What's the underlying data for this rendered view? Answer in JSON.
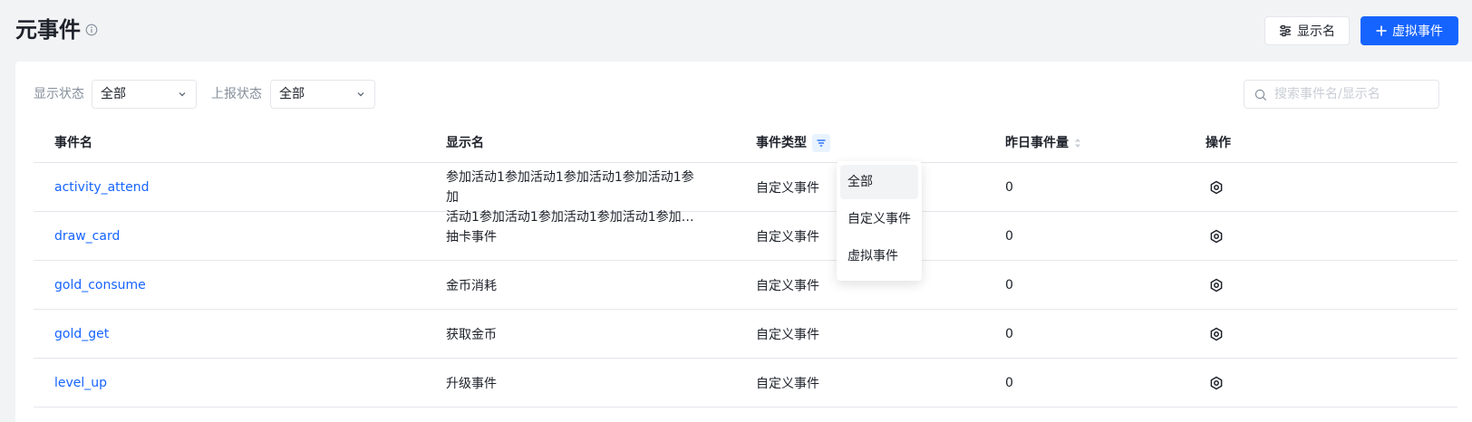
{
  "header": {
    "title": "元事件",
    "display_name_button": "显示名",
    "virtual_event_button": "虚拟事件"
  },
  "filters": {
    "display_status_label": "显示状态",
    "display_status_value": "全部",
    "report_status_label": "上报状态",
    "report_status_value": "全部",
    "search_placeholder": "搜索事件名/显示名"
  },
  "table": {
    "columns": [
      "事件名",
      "显示名",
      "事件类型",
      "昨日事件量",
      "操作"
    ],
    "rows": [
      {
        "event_name": "activity_attend",
        "display_name_line1": "参加活动1参加活动1参加活动1参加活动1参加",
        "display_name_line2": "活动1参加活动1参加活动1参加活动1参加活…",
        "event_type": "自定义事件",
        "yesterday_count": "0"
      },
      {
        "event_name": "draw_card",
        "display_name": "抽卡事件",
        "event_type": "自定义事件",
        "yesterday_count": "0"
      },
      {
        "event_name": "gold_consume",
        "display_name": "金币消耗",
        "event_type": "自定义事件",
        "yesterday_count": "0"
      },
      {
        "event_name": "gold_get",
        "display_name": "获取金币",
        "event_type": "自定义事件",
        "yesterday_count": "0"
      },
      {
        "event_name": "level_up",
        "display_name": "升级事件",
        "event_type": "自定义事件",
        "yesterday_count": "0"
      }
    ]
  },
  "event_type_dropdown": {
    "options": [
      "全部",
      "自定义事件",
      "虚拟事件"
    ],
    "selected": "全部"
  },
  "icons": {
    "info": "info-icon",
    "display_settings": "sliders-icon",
    "add": "plus-icon",
    "chevron": "chevron-down-icon",
    "search": "search-icon",
    "filter": "filter-icon",
    "sort": "sort-icon",
    "action": "gear-icon"
  },
  "colors": {
    "primary": "#1664ff",
    "background": "#f2f3f5",
    "border": "#e5e6eb"
  }
}
